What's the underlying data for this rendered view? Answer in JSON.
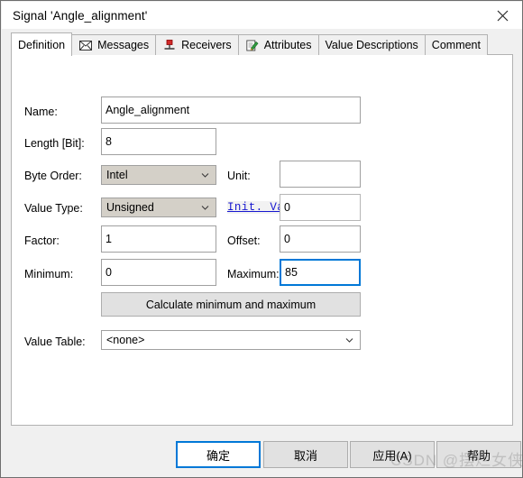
{
  "window": {
    "title": "Signal 'Angle_alignment'",
    "close_icon": "close-icon"
  },
  "tabs": [
    {
      "label": "Definition",
      "icon": "",
      "active": true
    },
    {
      "label": "Messages",
      "icon": "envelope-icon",
      "active": false
    },
    {
      "label": "Receivers",
      "icon": "pushpin-icon",
      "active": false
    },
    {
      "label": "Attributes",
      "icon": "pencil-note-icon",
      "active": false
    },
    {
      "label": "Value Descriptions",
      "icon": "",
      "active": false
    },
    {
      "label": "Comment",
      "icon": "",
      "active": false
    }
  ],
  "form": {
    "name_label": "Name:",
    "name_value": "Angle_alignment",
    "length_label": "Length [Bit]:",
    "length_value": "8",
    "byte_order_label": "Byte Order:",
    "byte_order_value": "Intel",
    "unit_label": "Unit:",
    "unit_value": "",
    "value_type_label": "Value Type:",
    "value_type_value": "Unsigned",
    "init_value_link": "Init. Value",
    "init_value": "0",
    "factor_label": "Factor:",
    "factor_value": "1",
    "offset_label": "Offset:",
    "offset_value": "0",
    "minimum_label": "Minimum:",
    "minimum_value": "0",
    "maximum_label": "Maximum:",
    "maximum_value": "85",
    "calculate_button": "Calculate minimum and maximum",
    "value_table_label": "Value Table:",
    "value_table_value": "<none>"
  },
  "footer": {
    "ok": "确定",
    "cancel": "取消",
    "apply": "应用(A)",
    "help": "帮助"
  },
  "watermark": "CSDN @摆烂女侠",
  "colors": {
    "accent": "#0078d7",
    "link": "#1818d0",
    "panel_border": "#b2b2b2",
    "button_face": "#e1e1e1",
    "combo_face": "#d4d0c8"
  }
}
